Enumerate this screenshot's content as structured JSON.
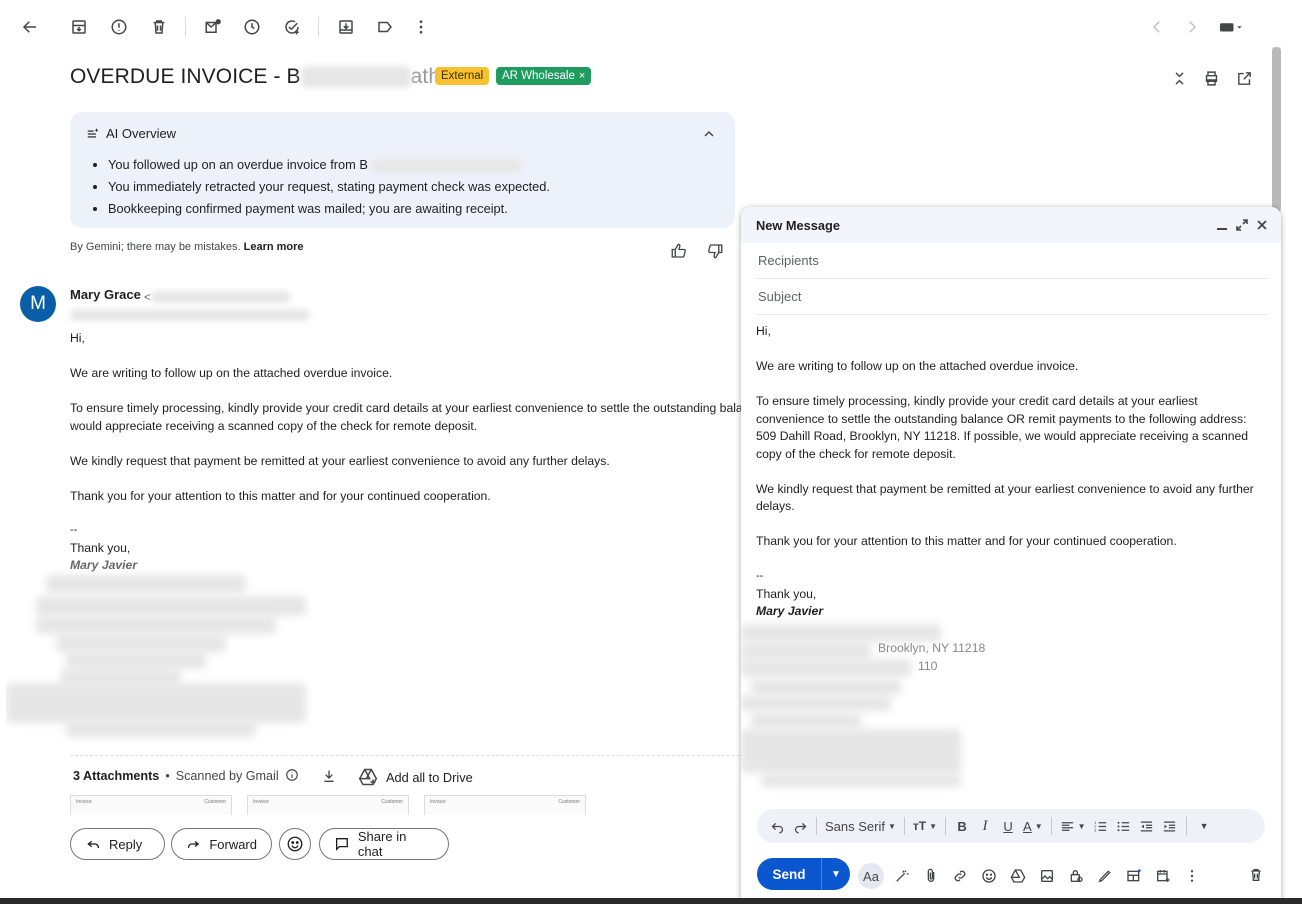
{
  "toolbar": {
    "icons": [
      "back-arrow-icon",
      "archive-icon",
      "report-spam-icon",
      "delete-icon",
      "mark-unread-icon",
      "snooze-icon",
      "add-task-icon",
      "move-to-icon",
      "label-icon",
      "more-vert-icon"
    ]
  },
  "email": {
    "subject_prefix": "OVERDUE INVOICE - B",
    "subject_suffix": "ath",
    "labels": {
      "external": "External",
      "ar_wholesale": "AR Wholesale"
    },
    "label_close": "×"
  },
  "ai_overview": {
    "title": "AI Overview",
    "bullets": [
      "You followed up on an overdue invoice from B",
      "You immediately retracted your request, stating payment check was expected.",
      "Bookkeeping confirmed payment was mailed; you are awaiting receipt."
    ],
    "note": "By Gemini; there may be mistakes.",
    "learn_more": "Learn more"
  },
  "message": {
    "avatar_letter": "M",
    "sender_name": "Mary Grace",
    "sender_email_start": "<",
    "greeting": "Hi,",
    "p1": "We are writing to follow up on the attached overdue invoice.",
    "p2a": "To ensure timely processing, kindly provide your credit card details at your earliest convenience to settle the outstanding balance C",
    "p2b": "would appreciate receiving a scanned copy of the check for remote deposit.",
    "p3": "We kindly request that payment be remitted at your earliest convenience to avoid any further delays.",
    "p4": "Thank you for your attention to this matter and for your continued cooperation.",
    "sig_dash": "--",
    "sig_thanks": "Thank you,",
    "sig_name": "Mary Javier"
  },
  "attachments": {
    "count_label": "3 Attachments",
    "scanned": "Scanned by Gmail",
    "add_drive": "Add all to Drive",
    "thumbs": [
      {
        "left": "Invoice",
        "right": "Customer"
      },
      {
        "left": "Invoice",
        "right": "Customer"
      },
      {
        "left": "Invoice",
        "right": "Customer"
      }
    ]
  },
  "actions": {
    "reply": "Reply",
    "forward": "Forward",
    "share": "Share in chat"
  },
  "compose": {
    "title": "New Message",
    "recipients_placeholder": "Recipients",
    "subject_placeholder": "Subject",
    "greeting": "Hi,",
    "p1": "We are writing to follow up on the attached overdue invoice.",
    "p2": "To ensure timely processing, kindly provide your credit card details at your earliest convenience to settle the outstanding balance OR remit payments to the following address: 509 Dahill Road, Brooklyn, NY 11218. If possible, we would appreciate receiving a scanned copy of the check for remote deposit.",
    "p3": "We kindly request that payment be remitted at your earliest convenience to avoid any further delays.",
    "p4": "Thank you for your attention to this matter and for your continued cooperation.",
    "sig_dash": "--",
    "sig_thanks": "Thank you,",
    "sig_name": "Mary Javier",
    "sig_visible_1": "Brooklyn, NY 11218",
    "sig_visible_2": "110",
    "font_name": "Sans Serif",
    "send": "Send",
    "aa": "Aa"
  },
  "colors": {
    "label_external": "#f7c22e",
    "label_ar": "#1e9b5f",
    "send_button": "#0b57d0",
    "ai_box": "#edf2fa",
    "avatar": "#0a5ea8"
  }
}
